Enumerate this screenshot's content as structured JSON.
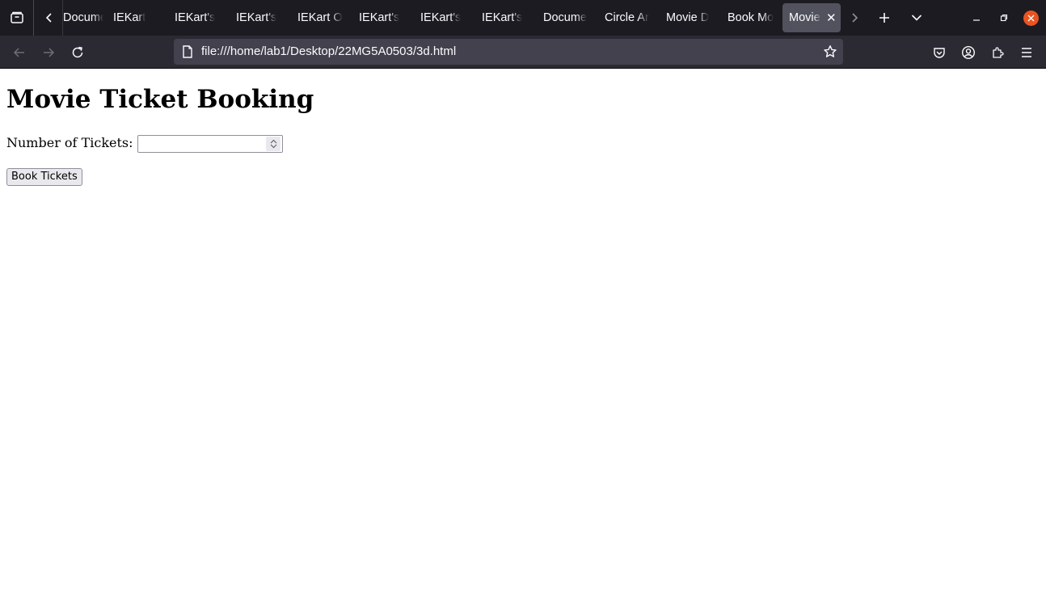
{
  "browser": {
    "tabs": [
      {
        "label": "Docume",
        "active": false
      },
      {
        "label": "IEKart",
        "active": false
      },
      {
        "label": "IEKart's",
        "active": false
      },
      {
        "label": "IEKart's",
        "active": false
      },
      {
        "label": "IEKart O",
        "active": false
      },
      {
        "label": "IEKart's",
        "active": false
      },
      {
        "label": "IEKart's",
        "active": false
      },
      {
        "label": "IEKart's",
        "active": false
      },
      {
        "label": "Docume",
        "active": false
      },
      {
        "label": "Circle Ar",
        "active": false
      },
      {
        "label": "Movie D",
        "active": false
      },
      {
        "label": "Book Mo",
        "active": false
      },
      {
        "label": "Movie",
        "active": true
      }
    ],
    "url": "file:///home/lab1/Desktop/22MG5A0503/3d.html",
    "colors": {
      "tabstrip_bg": "#1c1b22",
      "navbar_bg": "#2b2a33",
      "urlbar_bg": "#42414d",
      "close_red": "#e95420"
    }
  },
  "page": {
    "title": "Movie Ticket Booking",
    "tickets_label": "Number of Tickets:",
    "tickets_value": "",
    "book_button_label": "Book Tickets"
  }
}
